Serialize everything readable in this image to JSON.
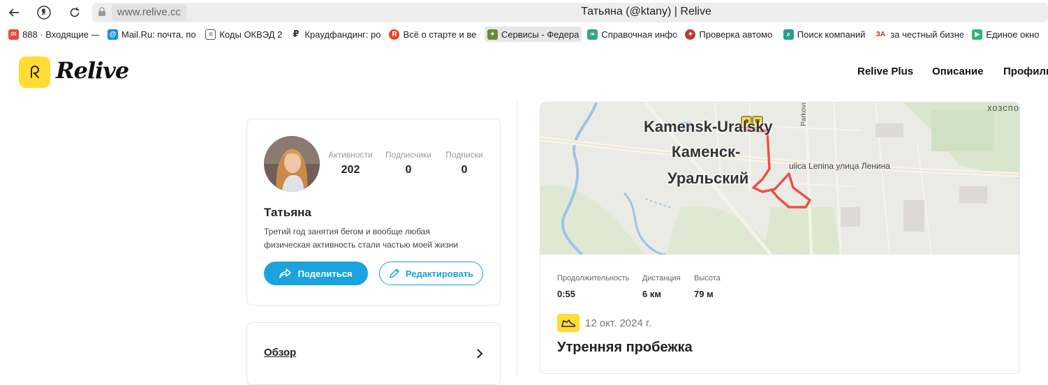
{
  "browser": {
    "url": "www.relive.cc",
    "tab_title": "Татьяна (@ktany) | Relive"
  },
  "bookmarks": [
    {
      "label": "888 · Входящие —",
      "icon": "mail-icon",
      "color": "#e84a3a"
    },
    {
      "label": "Mail.Ru: почта, по",
      "icon": "at-icon",
      "color": "#168de2"
    },
    {
      "label": "Коды ОКВЭД 2",
      "icon": "document-icon",
      "color": "#555555"
    },
    {
      "label": "Краудфандинг: ро",
      "icon": "ruble-icon",
      "color": "#333333"
    },
    {
      "label": "Всё о старте и ве",
      "icon": "r-circle-icon",
      "color": "#e8451f"
    },
    {
      "label": "Сервисы - Федера",
      "icon": "emblem-icon",
      "color": "#6a8a3a"
    },
    {
      "label": "Справочная инфо",
      "icon": "leaf-icon",
      "color": "#3aa57a"
    },
    {
      "label": "Проверка автомо",
      "icon": "emblem-icon",
      "color": "#c0392b"
    },
    {
      "label": "Поиск компаний",
      "icon": "search-icon",
      "color": "#2a9d8f"
    },
    {
      "label": "за честный бизне",
      "icon": "za-icon",
      "color": "#d62828"
    },
    {
      "label": "Единое окно",
      "icon": "play-icon",
      "color": "#2bb673"
    }
  ],
  "site": {
    "logo_text": "Relive",
    "nav": [
      "Relive Plus",
      "Описание",
      "Профиль"
    ]
  },
  "profile": {
    "name": "Татьяна",
    "bio": "Третий год занятия бегом и вообще любая физическая активность стали частью моей жизни",
    "stats": [
      {
        "label": "Активности",
        "value": "202"
      },
      {
        "label": "Подписчики",
        "value": "0"
      },
      {
        "label": "Подписки",
        "value": "0"
      }
    ],
    "share_label": "Поделиться",
    "edit_label": "Редактировать"
  },
  "overview": {
    "label": "Обзор"
  },
  "activity": {
    "map_labels": {
      "city_latin": "Kamensk-Uralsky",
      "city_ru_1": "Каменск-",
      "city_ru_2": "Уральский",
      "street": "ulica Lenina улица Ленина",
      "parkovaya": "Parkovaya",
      "corner": "хозспо"
    },
    "metrics": [
      {
        "label": "Продолжительность",
        "value": "0:55"
      },
      {
        "label": "Дистанция",
        "value": "6 км"
      },
      {
        "label": "Высота",
        "value": "79 м"
      }
    ],
    "date": "12 окт. 2024 г.",
    "title": "Утренняя пробежка",
    "route_color": "#e8524a"
  }
}
